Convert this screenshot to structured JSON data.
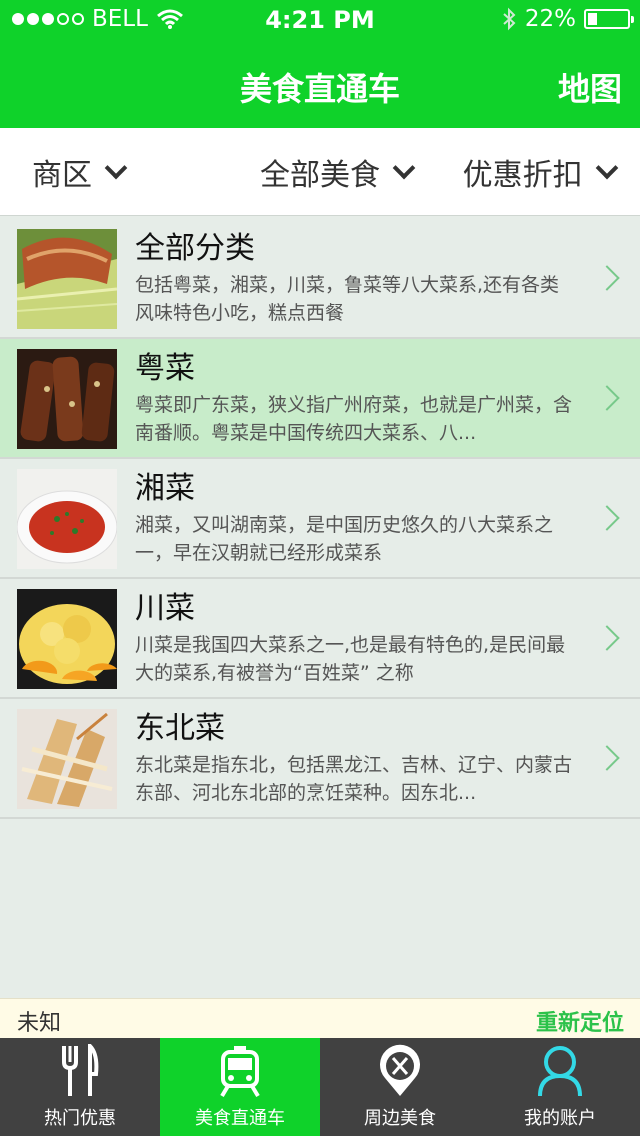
{
  "status_bar": {
    "carrier": "BELL",
    "time": "4:21 PM",
    "battery": "22%",
    "battery_level": 0.22
  },
  "nav": {
    "title": "美食直通车",
    "map_label": "地图"
  },
  "filters": [
    {
      "label": "商区"
    },
    {
      "label": "全部美食"
    },
    {
      "label": "优惠折扣"
    }
  ],
  "categories": [
    {
      "title": "全部分类",
      "desc": "包括粤菜，湘菜，川菜，鲁菜等八大菜系,还有各类风味特色小吃，糕点西餐",
      "selected": false
    },
    {
      "title": "粤菜",
      "desc": "粤菜即广东菜，狭义指广州府菜，也就是广州菜，含南番顺。粤菜是中国传统四大菜系、八...",
      "selected": true
    },
    {
      "title": "湘菜",
      "desc": "湘菜，又叫湖南菜，是中国历史悠久的八大菜系之一，早在汉朝就已经形成菜系",
      "selected": false
    },
    {
      "title": "川菜",
      "desc": "川菜是我国四大菜系之一,也是最有特色的,是民间最大的菜系,有被誉为“百姓菜” 之称",
      "selected": false
    },
    {
      "title": "东北菜",
      "desc": "东北菜是指东北，包括黑龙江、吉林、辽宁、内蒙古东部、河北东北部的烹饪菜种。因东北...",
      "selected": false
    }
  ],
  "location": {
    "current": "未知",
    "relocate_label": "重新定位"
  },
  "tabs": [
    {
      "label": "热门优惠",
      "icon": "fork-knife-icon"
    },
    {
      "label": "美食直通车",
      "icon": "train-icon",
      "active": true
    },
    {
      "label": "周边美食",
      "icon": "location-food-icon"
    },
    {
      "label": "我的账户",
      "icon": "user-icon"
    }
  ],
  "colors": {
    "brand_green": "#0fd22a",
    "selected_row": "#c8ecca",
    "tabbar": "#414141",
    "relocate": "#2cc24a"
  }
}
